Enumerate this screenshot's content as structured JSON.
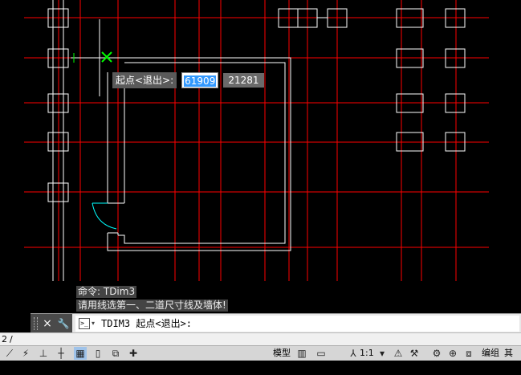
{
  "dynamic_input": {
    "prompt": "起点<退出>:",
    "x_value": "61909",
    "y_value": "21281"
  },
  "command_history": [
    "命令: TDim3",
    "请用线选第一、二道尺寸线及墙体!"
  ],
  "command_line": {
    "text": "TDIM3 起点<退出>:",
    "close_icon": "×",
    "settings_icon": "🔧"
  },
  "layout_tab": {
    "label": "2",
    "separator": "/"
  },
  "status_bar": {
    "model_label": "模型",
    "scale_label": "1:1",
    "edit_label": "编组",
    "other_label": "其他"
  },
  "colors": {
    "axis_red": "#ff0000",
    "wall_white": "#ffffff",
    "cursor_green": "#00ff00",
    "door_cyan": "#00ffff",
    "selection_blue": "#3399ff"
  }
}
